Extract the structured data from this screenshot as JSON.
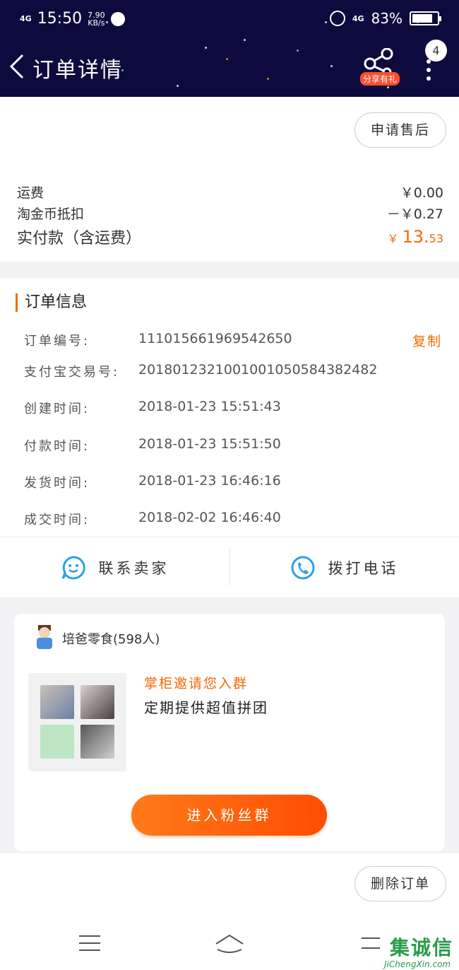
{
  "status_bar": {
    "network": "4G",
    "time": "15:50",
    "speed": "7.90",
    "speed_unit": "KB/s",
    "signal_right": "4G",
    "battery": "83%",
    "battery_level": 0.83
  },
  "header": {
    "back_icon": "chevron-left-icon",
    "title": "订单详情",
    "share_label": "分享有礼",
    "notification_count": "4"
  },
  "actions": {
    "after_sale": "申请售后",
    "delete_order": "删除订单"
  },
  "fees": {
    "shipping_label": "运费",
    "shipping_value": "￥0.00",
    "coin_label": "淘金币抵扣",
    "coin_value": "－￥0.27",
    "paid_label": "实付款（含运费）",
    "paid_symbol": "￥",
    "paid_int": "13.",
    "paid_dec": "53"
  },
  "order_info": {
    "title": "订单信息",
    "copy_label": "复制",
    "rows": [
      {
        "label": "订单编号:",
        "value": "111015661969542650"
      },
      {
        "label": "支付宝交易号:",
        "value": "2018012321001001050584382482"
      },
      {
        "label": "创建时间:",
        "value": "2018-01-23 15:51:43"
      },
      {
        "label": "付款时间:",
        "value": "2018-01-23 15:51:50"
      },
      {
        "label": "发货时间:",
        "value": "2018-01-23 16:46:16"
      },
      {
        "label": "成交时间:",
        "value": "2018-02-02 16:46:40"
      }
    ]
  },
  "contact": {
    "seller": "联系卖家",
    "phone": "拨打电话"
  },
  "group": {
    "name": "培爸零食(598人)",
    "invite": "掌柜邀请您入群",
    "desc": "定期提供超值拼团",
    "join": "进入粉丝群"
  },
  "watermark": {
    "text": "集诚信",
    "sub": "JiChengXin.com"
  },
  "colors": {
    "accent": "#f56a00",
    "header_bg": "#0d0b3d",
    "icon_blue": "#2aa1e6"
  }
}
